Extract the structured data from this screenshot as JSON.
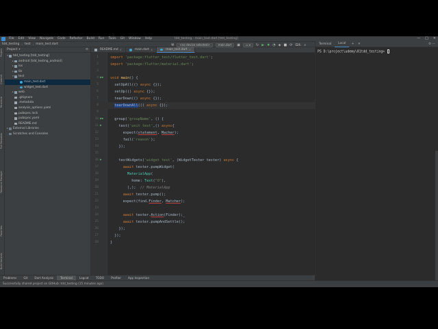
{
  "window": {
    "title": "tdd_testing - main_test.dart [tdd_testing]",
    "controls": [
      "—",
      "□",
      "✕"
    ]
  },
  "menu": [
    "File",
    "Edit",
    "View",
    "Navigate",
    "Code",
    "Refactor",
    "Build",
    "Run",
    "Tools",
    "Git",
    "Window",
    "Help"
  ],
  "breadcrumbs": [
    "tdd_testing",
    "test",
    "main_test.dart"
  ],
  "toolbar": {
    "device": "<no device selected>",
    "run_config": "main.dart",
    "git": "Git:"
  },
  "project_panel": {
    "title": "Project",
    "tree": [
      {
        "label": "tdd_testing [tdd_testing]",
        "depth": 0,
        "icon": "folder",
        "tri": "▾",
        "sel": false
      },
      {
        "label": "android [tdd_testing_android]",
        "depth": 1,
        "icon": "folder",
        "tri": "▸",
        "sel": false
      },
      {
        "label": "ios",
        "depth": 1,
        "icon": "folder",
        "tri": "▸",
        "sel": false
      },
      {
        "label": "lib",
        "depth": 1,
        "icon": "folder",
        "tri": "▸",
        "sel": false
      },
      {
        "label": "test",
        "depth": 1,
        "icon": "folder",
        "tri": "▾",
        "sel": false
      },
      {
        "label": "main_test.dart",
        "depth": 2,
        "icon": "dart",
        "tri": "",
        "sel": true
      },
      {
        "label": "widget_test.dart",
        "depth": 2,
        "icon": "dart",
        "tri": "",
        "sel": false
      },
      {
        "label": "web",
        "depth": 1,
        "icon": "folder",
        "tri": "▸",
        "sel": false
      },
      {
        "label": ".gitignore",
        "depth": 1,
        "icon": "file",
        "tri": "",
        "sel": false
      },
      {
        "label": ".metadata",
        "depth": 1,
        "icon": "file",
        "tri": "",
        "sel": false
      },
      {
        "label": "analysis_options.yaml",
        "depth": 1,
        "icon": "file",
        "tri": "",
        "sel": false
      },
      {
        "label": "pubspec.lock",
        "depth": 1,
        "icon": "file",
        "tri": "",
        "sel": false
      },
      {
        "label": "pubspec.yaml",
        "depth": 1,
        "icon": "file",
        "tri": "",
        "sel": false
      },
      {
        "label": "README.md",
        "depth": 1,
        "icon": "file",
        "tri": "",
        "sel": false
      },
      {
        "label": "External Libraries",
        "depth": 0,
        "icon": "lib",
        "tri": "▸",
        "sel": false
      },
      {
        "label": "Scratches and Consoles",
        "depth": 0,
        "icon": "lib",
        "tri": "",
        "sel": false
      }
    ]
  },
  "left_strip_tabs": [
    "Project",
    "Commit",
    "Structure",
    "Pull Requests",
    "Resource Manager",
    "Favorites",
    "Build Variants"
  ],
  "editor_tabs": [
    {
      "label": "README.md",
      "active": false
    },
    {
      "label": "main.dart",
      "active": false
    },
    {
      "label": "main_test.dart",
      "active": true
    }
  ],
  "code": [
    {
      "ln": "1",
      "mark": "",
      "cur": false,
      "html": "<span class=\"kw\">import</span> <span class=\"str\">'package:flutter_test/flutter_test.dart'</span>;"
    },
    {
      "ln": "2",
      "mark": "",
      "cur": false,
      "html": "<span class=\"kw\">import</span> <span class=\"str\">'package:flutter/material.dart'</span>;"
    },
    {
      "ln": "3",
      "mark": "",
      "cur": false,
      "html": ""
    },
    {
      "ln": "4",
      "mark": "▶▶",
      "cur": false,
      "html": "<span class=\"kw\">void</span> <span class=\"fn\">main</span>() {"
    },
    {
      "ln": "5",
      "mark": "",
      "cur": false,
      "html": "  setUpAll(() <span class=\"kw\">async</span> {});"
    },
    {
      "ln": "6",
      "mark": "",
      "cur": false,
      "html": "  setUp(() <span class=\"kw\">async</span> {});"
    },
    {
      "ln": "7",
      "mark": "",
      "cur": false,
      "html": "  tearDown(() <span class=\"kw\">async</span> {});"
    },
    {
      "ln": "8",
      "mark": "",
      "cur": true,
      "html": "  <span class=\"hl\">tearDownAll</span>(() <span class=\"kw\">async</span> {});"
    },
    {
      "ln": "9",
      "mark": "",
      "cur": false,
      "html": ""
    },
    {
      "ln": "10",
      "mark": "▶▶",
      "cur": false,
      "html": "  group(<span class=\"str\">'groupName'</span>, () {"
    },
    {
      "ln": "11",
      "mark": "▶",
      "cur": false,
      "html": "    test(<span class=\"str\">'unit test'</span>,() <span class=\"kw\">async</span>{"
    },
    {
      "ln": "12",
      "mark": "",
      "cur": false,
      "html": "      expect(<span class=\"und\">statement</span>, <span class=\"und\">Macher</span>);"
    },
    {
      "ln": "13",
      "mark": "",
      "cur": false,
      "html": "      fail(<span class=\"str\">'reason'</span>);"
    },
    {
      "ln": "14",
      "mark": "",
      "cur": false,
      "html": "    });"
    },
    {
      "ln": "15",
      "mark": "",
      "cur": false,
      "html": ""
    },
    {
      "ln": "16",
      "mark": "▶",
      "cur": false,
      "html": "    testWidgets(<span class=\"str\">'widget test'</span>, (WidgetTester tester) <span class=\"kw\">async</span> {"
    },
    {
      "ln": "17",
      "mark": "",
      "cur": false,
      "html": "      <span class=\"kw\">await</span> tester.pumpWidget("
    },
    {
      "ln": "18",
      "mark": "",
      "cur": false,
      "html": "        <span class=\"cls\">MaterialApp</span>("
    },
    {
      "ln": "19",
      "mark": "",
      "cur": false,
      "html": "          home: <span class=\"cls\">Text</span>(<span class=\"str\">\"0\"</span>),"
    },
    {
      "ln": "20",
      "mark": "",
      "cur": false,
      "html": "        ),);  <span class=\"cmt\">// MaterialApp</span>"
    },
    {
      "ln": "21",
      "mark": "",
      "cur": false,
      "html": "      <span class=\"kw\">await</span> tester.pump();"
    },
    {
      "ln": "22",
      "mark": "",
      "cur": false,
      "html": "      expect(find.<span class=\"und\">Finder</span>, <span class=\"und\">Matcher</span>);"
    },
    {
      "ln": "23",
      "mark": "",
      "cur": false,
      "html": ""
    },
    {
      "ln": "24",
      "mark": "",
      "cur": false,
      "html": "      <span class=\"kw\">await</span> tester.<span class=\"und\">Action</span>(Finder);_"
    },
    {
      "ln": "25",
      "mark": "",
      "cur": false,
      "html": "      <span class=\"kw\">await</span> tester.pumpAndSettle();"
    },
    {
      "ln": "26",
      "mark": "",
      "cur": false,
      "html": "    });"
    },
    {
      "ln": "27",
      "mark": "",
      "cur": false,
      "html": "  });"
    },
    {
      "ln": "28",
      "mark": "",
      "cur": false,
      "html": "}"
    }
  ],
  "terminal": {
    "tab": "Terminal",
    "local_tab": "Local",
    "prompt": "PS D:\\project\\udemy\\01tdd_testing> "
  },
  "bottom_tabs": [
    "Problems",
    "Git",
    "Dart Analysis",
    "Terminal",
    "Logcat",
    "TODO",
    "Profiler",
    "App Inspection"
  ],
  "active_bottom_tab": "Terminal",
  "status": "Successfully shared project on GitHub: tdd_testing (15 minutes ago)",
  "colors": {
    "accent": "#4a88c7",
    "run": "#59a869",
    "selection": "#214283"
  }
}
